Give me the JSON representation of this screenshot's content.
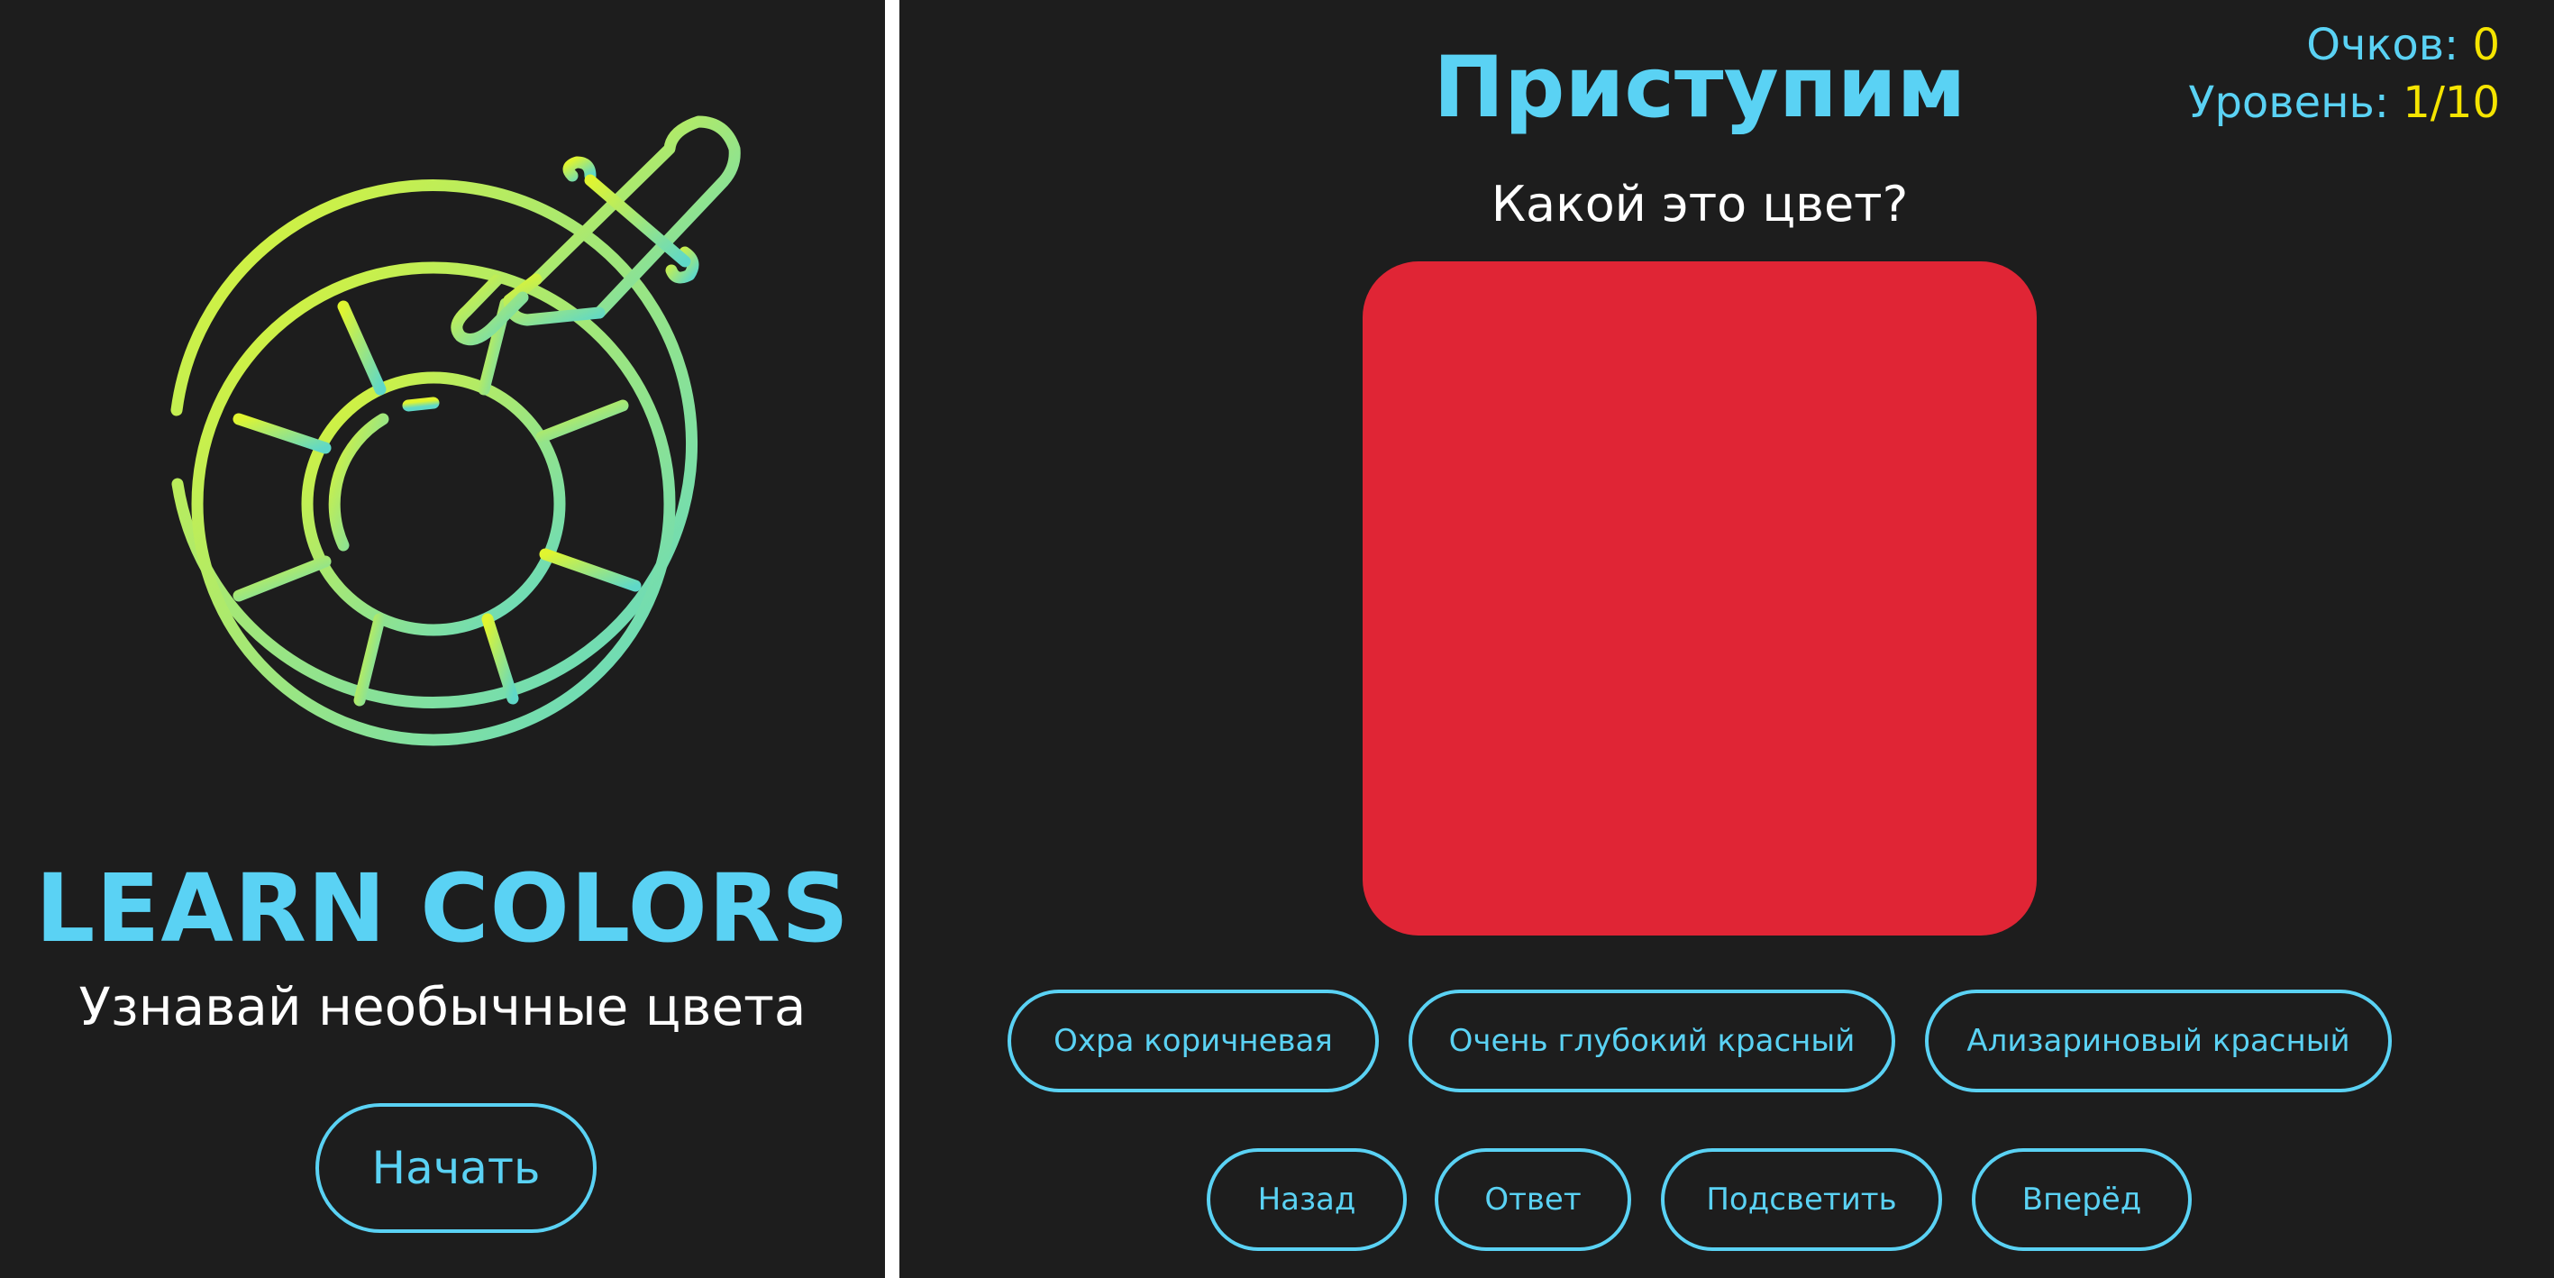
{
  "welcome": {
    "title": "LEARN COLORS",
    "subtitle": "Узнавай необычные цвета",
    "start_button": "Начать",
    "logo_icon": "color-wheel-eyedropper-icon"
  },
  "game": {
    "heading": "Приступим",
    "score_label": "Очков:",
    "score_value": "0",
    "level_label": "Уровень:",
    "level_value": "1/10",
    "question": "Какой это цвет?",
    "swatch_color": "#e02535",
    "answers": [
      "Охра коричневая",
      "Очень глубокий красный",
      "Ализариновый красный"
    ],
    "nav": {
      "back": "Назад",
      "answer": "Ответ",
      "highlight": "Подсветить",
      "forward": "Вперёд"
    }
  },
  "colors": {
    "background": "#1d1d1d",
    "accent": "#5ad2f4",
    "value_yellow": "#f5e400",
    "gradient_start": "#d8f23a",
    "gradient_end": "#5fd8c8"
  }
}
